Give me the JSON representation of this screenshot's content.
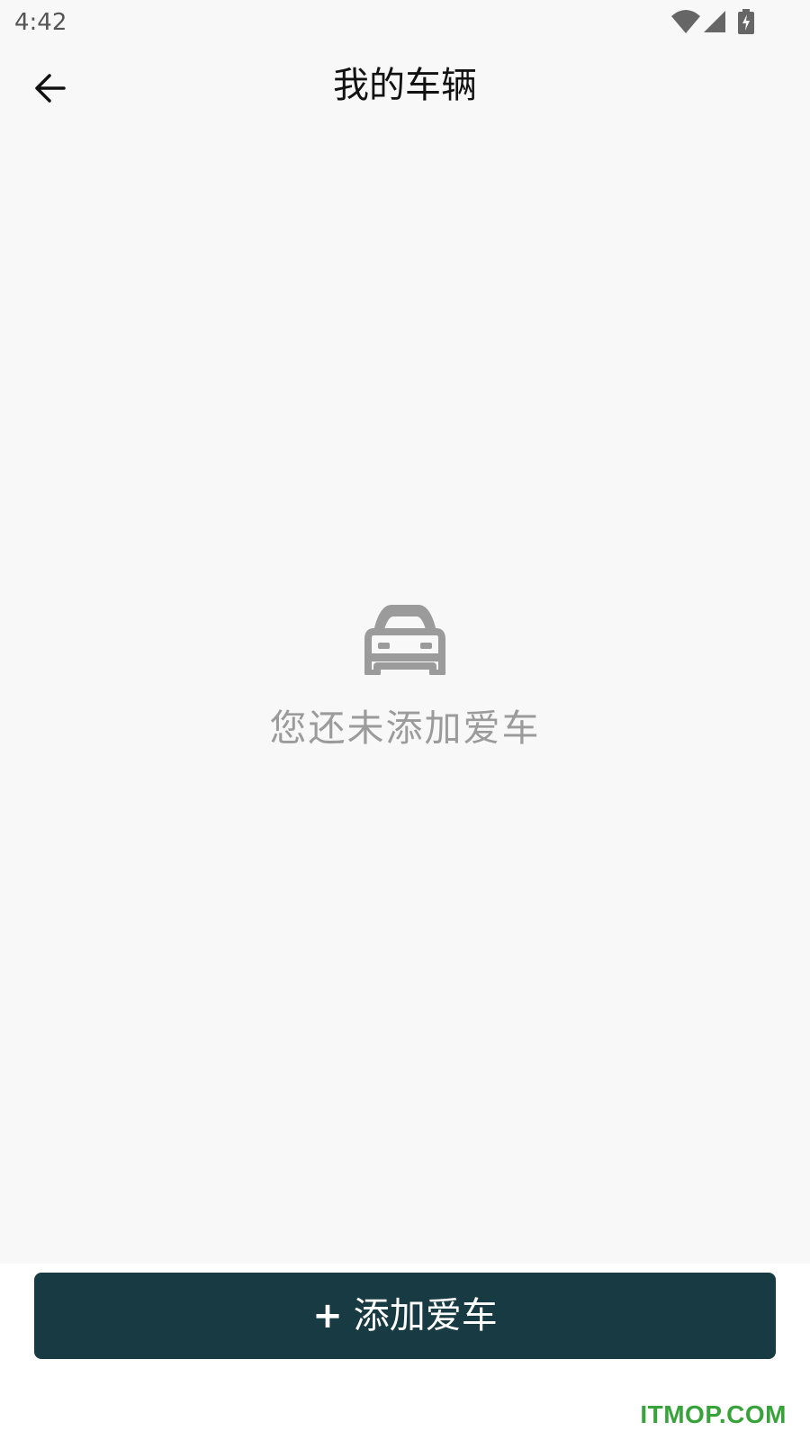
{
  "status_bar": {
    "time": "4:42",
    "icons": [
      "wifi-icon",
      "signal-icon",
      "battery-charging-icon"
    ]
  },
  "app_bar": {
    "back_icon": "arrow-left-icon",
    "title": "我的车辆"
  },
  "empty_state": {
    "icon": "car-icon",
    "message": "您还未添加爱车"
  },
  "add_button": {
    "icon": "+",
    "label": "添加爱车"
  },
  "watermark": {
    "text": "ITMOP.COM"
  },
  "colors": {
    "background": "#f8f8f8",
    "button": "#183a42",
    "empty_icon": "#9b9b9b",
    "watermark": "#38a33a"
  }
}
